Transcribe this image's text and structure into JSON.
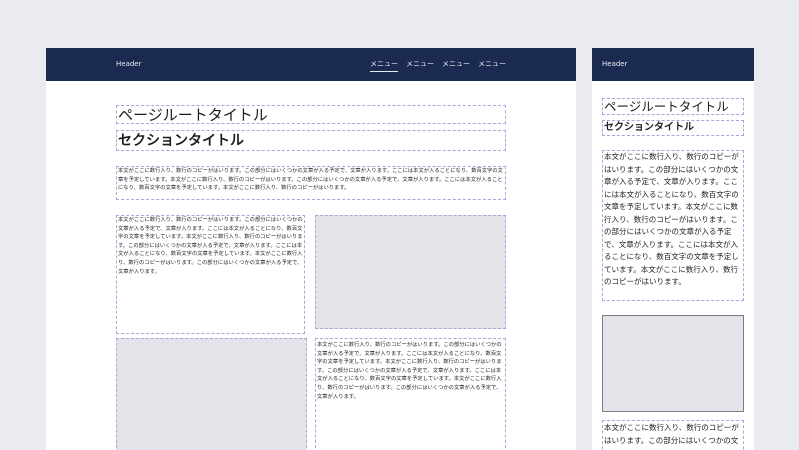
{
  "desktop": {
    "header_title": "Header",
    "nav": [
      "メニュー",
      "メニュー",
      "メニュー",
      "メニュー"
    ],
    "page_title": "ページルートタイトル",
    "section_title": "セクションタイトル",
    "intro_text": "本文がここに数行入り、数行のコピーがはいります。この部分にはいくつかの文章が入る予定で、文章が入ります。ここには本文が入ることになり、数百文字の文章を予定しています。本文がここに数行入り、数行のコピーがはいります。この部分にはいくつかの文章が入る予定で、文章が入ります。ここには本文が入ることになり、数百文字の文章を予定しています。本文がここに数行入り、数行のコピーがはいります。",
    "col_text_1": "本文がここに数行入り、数行のコピーがはいります。この部分にはいくつかの文章が入る予定で、文章が入ります。ここには本文が入ることになり、数百文字の文章を予定しています。本文がここに数行入り、数行のコピーがはいります。この部分にはいくつかの文章が入る予定で、文章が入ります。ここには本文が入ることになり、数百文字の文章を予定しています。本文がここに数行入り、数行のコピーがはいります。この部分にはいくつかの文章が入る予定で、文章が入ります。",
    "col_text_2": "本文がここに数行入り、数行のコピーがはいります。この部分にはいくつかの文章が入る予定で、文章が入ります。ここには本文が入ることになり、数百文字の文章を予定しています。本文がここに数行入り、数行のコピーがはいります。この部分にはいくつかの文章が入る予定で、文章が入ります。ここには本文が入ることになり、数百文字の文章を予定しています。本文がここに数行入り、数行のコピーがはいります。この部分にはいくつかの文章が入る予定で、文章が入ります。"
  },
  "mobile": {
    "header_title": "Header",
    "page_title": "ページルートタイトル",
    "section_title": "セクションタイトル",
    "body_text": "本文がここに数行入り、数行のコピーがはいります。この部分にはいくつかの文章が入る予定で、文章が入ります。ここには本文が入ることになり、数百文字の文章を予定しています。本文がここに数行入り、数行のコピーがはいります。この部分にはいくつかの文章が入る予定で、文章が入ります。ここには本文が入ることになり、数百文字の文章を予定しています。本文がここに数行入り、数行のコピーがはいります。",
    "body_text_2": "本文がここに数行入り、数行のコピーがはいります。この部分にはいくつかの文"
  }
}
